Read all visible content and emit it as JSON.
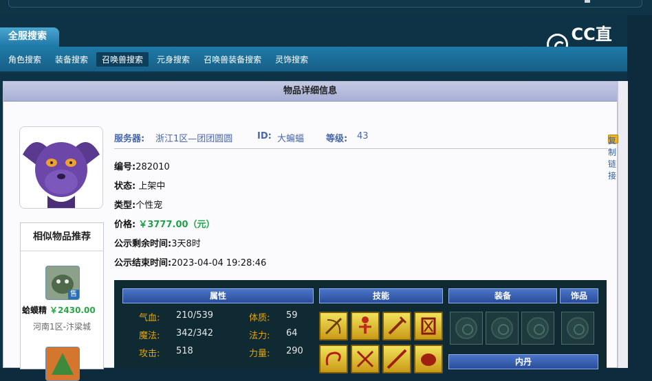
{
  "header": {
    "main_tab": "全服搜索",
    "logo_text": "CC直播"
  },
  "nav": {
    "items": [
      "角色搜索",
      "装备搜索",
      "召唤兽搜索",
      "元身搜索",
      "召唤兽装备搜索",
      "灵饰搜索"
    ],
    "active_index": 2
  },
  "detail": {
    "title": "物品详细信息",
    "server_label": "服务器:",
    "server_value": "浙江1区—团团圆圆",
    "id_label": "ID:",
    "id_value": "大蝙蝠",
    "level_label": "等级:",
    "level_value": "43",
    "copy_link": "复制链接",
    "number_label": "编号:",
    "number_value": "282010",
    "status_label": "状态:",
    "status_value": "上架中",
    "type_label": "类型:",
    "type_value": "个性宠",
    "price_label": "价格:",
    "price_value": "￥3777.00（元）",
    "remain_label": "公示剩余时间:",
    "remain_value": "3天8时",
    "end_label": "公示结束时间:",
    "end_value": "2023-04-04 19:28:46"
  },
  "recommend": {
    "title": "相似物品推荐",
    "items": [
      {
        "name": "蛤蟆精",
        "price": "￥2430.00",
        "server": "河南1区-汴梁城",
        "badge": "售"
      }
    ]
  },
  "panel": {
    "headers": {
      "attr": "属性",
      "skill": "技能",
      "equip": "装备",
      "orn": "饰品",
      "neidan": "内丹"
    },
    "attributes": [
      {
        "k": "气血:",
        "v": "210/539",
        "k2": "体质:",
        "v2": "59"
      },
      {
        "k": "魔法:",
        "v": "342/342",
        "k2": "法力:",
        "v2": "64"
      },
      {
        "k": "攻击:",
        "v": "518",
        "k2": "力量:",
        "v2": "290"
      }
    ]
  },
  "colors": {
    "accent_blue": "#1e7aa7",
    "price_green": "#21a24a",
    "attr_orange": "#e9a400"
  }
}
